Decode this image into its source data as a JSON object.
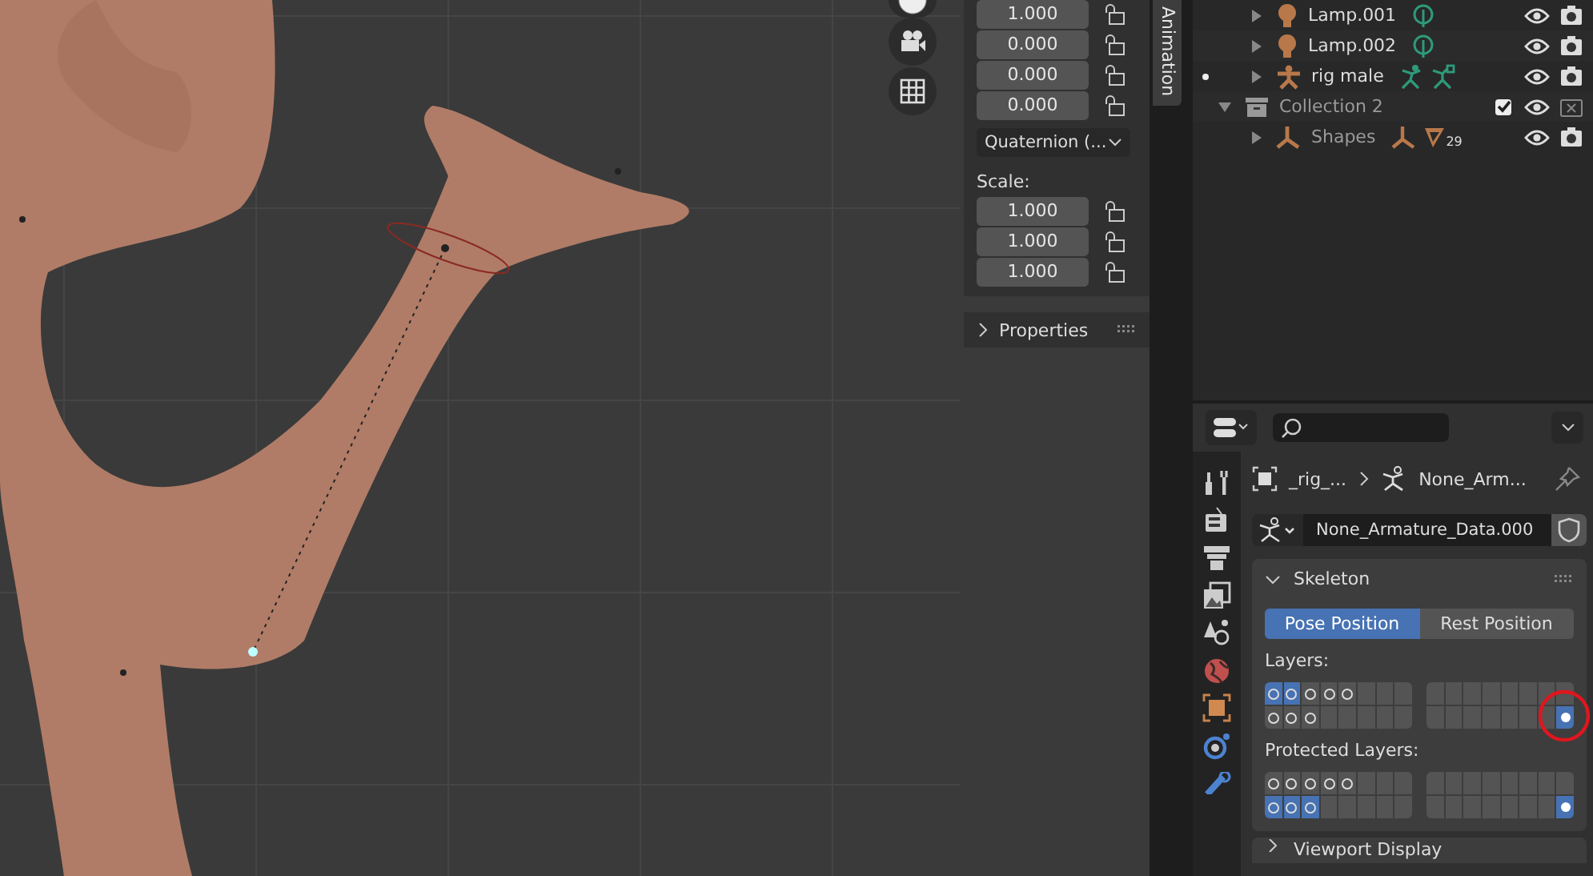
{
  "sidebar": {
    "rotation": [
      {
        "value": "1.000",
        "locked": false
      },
      {
        "value": "0.000",
        "locked": false
      },
      {
        "value": "0.000",
        "locked": false
      },
      {
        "value": "0.000",
        "locked": false
      }
    ],
    "rotation_mode": "Quaternion (...",
    "scale_label": "Scale:",
    "scale": [
      {
        "value": "1.000",
        "locked": false
      },
      {
        "value": "1.000",
        "locked": false
      },
      {
        "value": "1.000",
        "locked": false
      }
    ],
    "properties_panel": {
      "label": "Properties",
      "expanded": false
    }
  },
  "tabs": [
    {
      "label": "Animation",
      "selected": true
    }
  ],
  "outliner": {
    "rows": [
      {
        "name": "Lamp.001",
        "kind": "lamp",
        "expanded": false,
        "active": false,
        "dimmed": false,
        "visible": true,
        "renderable": true,
        "data_icons": [
          {
            "kind": "light"
          }
        ]
      },
      {
        "name": "Lamp.002",
        "kind": "lamp",
        "expanded": false,
        "active": false,
        "dimmed": false,
        "visible": true,
        "renderable": true,
        "data_icons": [
          {
            "kind": "light"
          }
        ]
      },
      {
        "name": "rig male",
        "kind": "armature",
        "expanded": false,
        "active": true,
        "dimmed": false,
        "visible": true,
        "renderable": true,
        "data_icons": [
          {
            "kind": "pose"
          },
          {
            "kind": "bone"
          }
        ]
      },
      {
        "name": "Collection 2",
        "kind": "collection",
        "expanded": true,
        "active": false,
        "dimmed": true,
        "checked": true,
        "visible": true,
        "renderable": false,
        "data_icons": [],
        "children": [
          {
            "name": "Shapes",
            "kind": "mesh",
            "expanded": false,
            "active": false,
            "dimmed": true,
            "visible": true,
            "renderable": true,
            "data_icons": [
              {
                "kind": "mesh"
              },
              {
                "kind": "vertex_groups",
                "count": "29"
              }
            ]
          }
        ]
      }
    ]
  },
  "properties": {
    "tabs": [
      {
        "kind": "tool"
      },
      {
        "kind": "render"
      },
      {
        "kind": "output"
      },
      {
        "kind": "view_layer"
      },
      {
        "kind": "scene"
      },
      {
        "kind": "world"
      },
      {
        "kind": "object"
      },
      {
        "kind": "physics"
      },
      {
        "kind": "data"
      }
    ],
    "breadcrumb": [
      "_rig_...",
      "None_Arm..."
    ],
    "datablock": "None_Armature_Data.000",
    "fake_user": false,
    "skeleton": {
      "title": "Skeleton",
      "expanded": true,
      "positions": [
        {
          "label": "Pose Position",
          "selected": true
        },
        {
          "label": "Rest Position",
          "selected": false
        }
      ],
      "layers_label": "Layers:",
      "layers": [
        [
          {
            "selected": true,
            "has_bones": true,
            "has_active_bone": false
          },
          {
            "selected": true,
            "has_bones": true,
            "has_active_bone": false
          },
          {
            "selected": false,
            "has_bones": true,
            "has_active_bone": false
          },
          {
            "selected": false,
            "has_bones": true,
            "has_active_bone": false
          },
          {
            "selected": false,
            "has_bones": true,
            "has_active_bone": false
          },
          {
            "selected": false,
            "has_bones": false,
            "has_active_bone": false
          },
          {
            "selected": false,
            "has_bones": false,
            "has_active_bone": false
          },
          {
            "selected": false,
            "has_bones": false,
            "has_active_bone": false
          },
          {
            "selected": false,
            "has_bones": false,
            "has_active_bone": false
          },
          {
            "selected": false,
            "has_bones": false,
            "has_active_bone": false
          },
          {
            "selected": false,
            "has_bones": false,
            "has_active_bone": false
          },
          {
            "selected": false,
            "has_bones": false,
            "has_active_bone": false
          },
          {
            "selected": false,
            "has_bones": false,
            "has_active_bone": false
          },
          {
            "selected": false,
            "has_bones": false,
            "has_active_bone": false
          },
          {
            "selected": false,
            "has_bones": false,
            "has_active_bone": false
          },
          {
            "selected": false,
            "has_bones": false,
            "has_active_bone": false
          }
        ],
        [
          {
            "selected": false,
            "has_bones": true,
            "has_active_bone": false
          },
          {
            "selected": false,
            "has_bones": true,
            "has_active_bone": false
          },
          {
            "selected": false,
            "has_bones": true,
            "has_active_bone": false
          },
          {
            "selected": false,
            "has_bones": false,
            "has_active_bone": false
          },
          {
            "selected": false,
            "has_bones": false,
            "has_active_bone": false
          },
          {
            "selected": false,
            "has_bones": false,
            "has_active_bone": false
          },
          {
            "selected": false,
            "has_bones": false,
            "has_active_bone": false
          },
          {
            "selected": false,
            "has_bones": false,
            "has_active_bone": false
          },
          {
            "selected": false,
            "has_bones": false,
            "has_active_bone": false
          },
          {
            "selected": false,
            "has_bones": false,
            "has_active_bone": false
          },
          {
            "selected": false,
            "has_bones": false,
            "has_active_bone": false
          },
          {
            "selected": false,
            "has_bones": false,
            "has_active_bone": false
          },
          {
            "selected": false,
            "has_bones": false,
            "has_active_bone": false
          },
          {
            "selected": false,
            "has_bones": false,
            "has_active_bone": false
          },
          {
            "selected": false,
            "has_bones": false,
            "has_active_bone": false
          },
          {
            "selected": true,
            "has_bones": true,
            "has_active_bone": true
          }
        ]
      ],
      "protected_label": "Protected Layers:",
      "protected": [
        [
          {
            "selected": false,
            "has_bones": true,
            "has_active_bone": false
          },
          {
            "selected": false,
            "has_bones": true,
            "has_active_bone": false
          },
          {
            "selected": false,
            "has_bones": true,
            "has_active_bone": false
          },
          {
            "selected": false,
            "has_bones": true,
            "has_active_bone": false
          },
          {
            "selected": false,
            "has_bones": true,
            "has_active_bone": false
          },
          {
            "selected": false,
            "has_bones": false,
            "has_active_bone": false
          },
          {
            "selected": false,
            "has_bones": false,
            "has_active_bone": false
          },
          {
            "selected": false,
            "has_bones": false,
            "has_active_bone": false
          },
          {
            "selected": false,
            "has_bones": false,
            "has_active_bone": false
          },
          {
            "selected": false,
            "has_bones": false,
            "has_active_bone": false
          },
          {
            "selected": false,
            "has_bones": false,
            "has_active_bone": false
          },
          {
            "selected": false,
            "has_bones": false,
            "has_active_bone": false
          },
          {
            "selected": false,
            "has_bones": false,
            "has_active_bone": false
          },
          {
            "selected": false,
            "has_bones": false,
            "has_active_bone": false
          },
          {
            "selected": false,
            "has_bones": false,
            "has_active_bone": false
          },
          {
            "selected": false,
            "has_bones": false,
            "has_active_bone": false
          }
        ],
        [
          {
            "selected": true,
            "has_bones": true,
            "has_active_bone": false
          },
          {
            "selected": true,
            "has_bones": true,
            "has_active_bone": false
          },
          {
            "selected": true,
            "has_bones": true,
            "has_active_bone": false
          },
          {
            "selected": false,
            "has_bones": false,
            "has_active_bone": false
          },
          {
            "selected": false,
            "has_bones": false,
            "has_active_bone": false
          },
          {
            "selected": false,
            "has_bones": false,
            "has_active_bone": false
          },
          {
            "selected": false,
            "has_bones": false,
            "has_active_bone": false
          },
          {
            "selected": false,
            "has_bones": false,
            "has_active_bone": false
          },
          {
            "selected": false,
            "has_bones": false,
            "has_active_bone": false
          },
          {
            "selected": false,
            "has_bones": false,
            "has_active_bone": false
          },
          {
            "selected": false,
            "has_bones": false,
            "has_active_bone": false
          },
          {
            "selected": false,
            "has_bones": false,
            "has_active_bone": false
          },
          {
            "selected": false,
            "has_bones": false,
            "has_active_bone": false
          },
          {
            "selected": false,
            "has_bones": false,
            "has_active_bone": false
          },
          {
            "selected": false,
            "has_bones": false,
            "has_active_bone": false
          },
          {
            "selected": true,
            "has_bones": true,
            "has_active_bone": true
          }
        ]
      ]
    },
    "viewport_display": {
      "title": "Viewport Display",
      "expanded": false
    }
  }
}
